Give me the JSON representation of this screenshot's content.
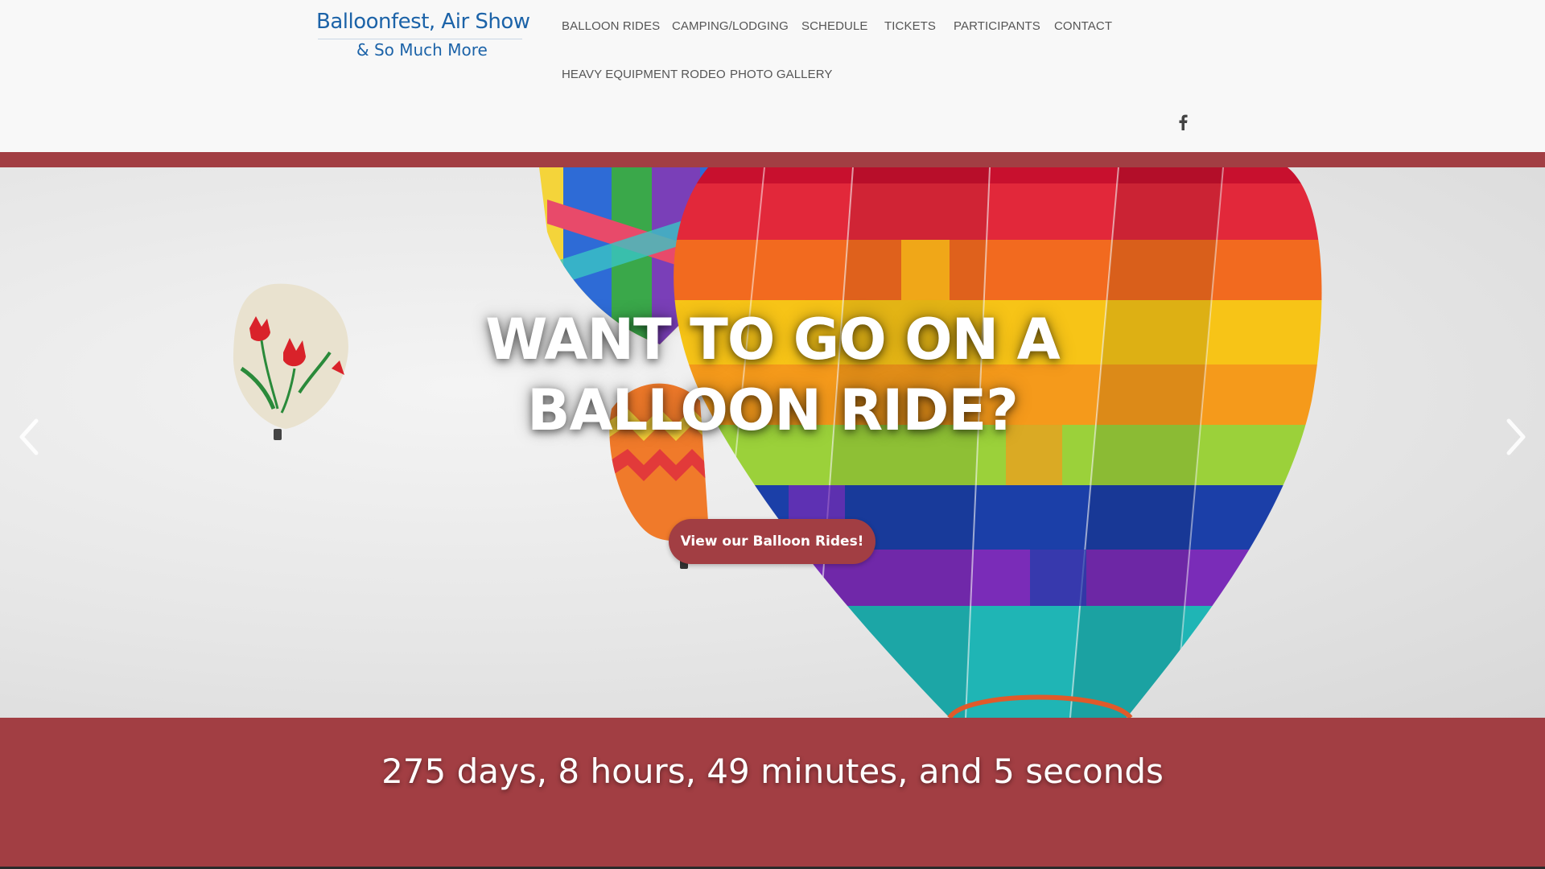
{
  "logo": {
    "line1": "Balloonfest, Air Show",
    "line2": "& So Much More"
  },
  "nav": {
    "items": [
      {
        "label": "BALLOON RIDES"
      },
      {
        "label": "CAMPING/LODGING"
      },
      {
        "label": "SCHEDULE"
      },
      {
        "label": "TICKETS"
      },
      {
        "label": "PARTICIPANTS"
      },
      {
        "label": "CONTACT"
      },
      {
        "label": "HEAVY EQUIPMENT RODEO"
      },
      {
        "label": "PHOTO GALLERY"
      }
    ]
  },
  "social": {
    "icon": "facebook-icon"
  },
  "hero": {
    "title": "WANT TO GO ON A BALLOON RIDE?",
    "cta_label": "View our Balloon Rides!",
    "prev_icon": "chevron-left-icon",
    "next_icon": "chevron-right-icon"
  },
  "countdown": {
    "text": "275 days, 8 hours, 49 minutes, and 5 seconds"
  },
  "colors": {
    "brand_red": "#a23e43",
    "logo_blue": "#1c63a8",
    "nav_text": "#555555",
    "header_bg": "#f8f8f8"
  }
}
